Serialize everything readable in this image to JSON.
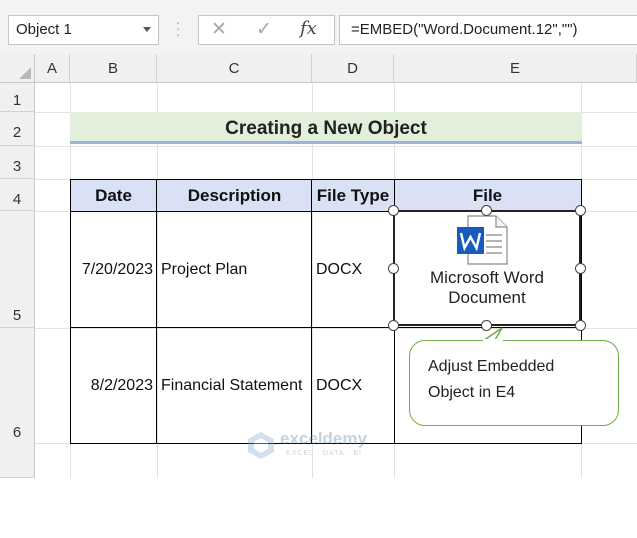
{
  "name_box": {
    "value": "Object 1"
  },
  "formula_bar": {
    "cancel_icon": "✕",
    "enter_icon": "✓",
    "fx_label": "fx",
    "formula": "=EMBED(\"Word.Document.12\",\"\")"
  },
  "columns": [
    "A",
    "B",
    "C",
    "D",
    "E"
  ],
  "rows": [
    "1",
    "2",
    "3",
    "4",
    "5",
    "6"
  ],
  "sheet": {
    "title": "Creating a New Object",
    "table": {
      "headers": [
        "Date",
        "Description",
        "File Type",
        "File"
      ],
      "rows": [
        {
          "date": "7/20/2023",
          "description": "Project Plan",
          "file_type": "DOCX"
        },
        {
          "date": "8/2/2023",
          "description": "Financial Statement",
          "file_type": "DOCX"
        }
      ]
    }
  },
  "embedded_object": {
    "label_line1": "Microsoft Word",
    "label_line2": "Document",
    "icon": "word-doc-icon"
  },
  "callout": {
    "line1": "Adjust Embedded",
    "line2": "Object in E4"
  },
  "watermark": {
    "brand": "exceldemy",
    "tagline": "EXCEL · DATA · BI"
  },
  "colors": {
    "title_fill": "#e2efda",
    "header_fill": "#dbe1f5",
    "callout_border": "#70ad47",
    "word_blue": "#185abd"
  }
}
